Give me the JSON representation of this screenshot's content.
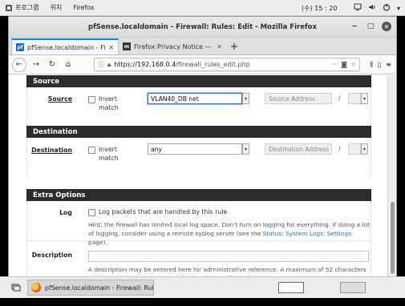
{
  "gnome_panel": {
    "apps_menu": "프로그램",
    "places_menu": "위치",
    "active_app": "Firefox",
    "clock": "(수) 15 : 20"
  },
  "window": {
    "title": "pfSense.localdomain - Firewall: Rules: Edit - Mozilla Firefox"
  },
  "tabs": [
    {
      "label": "pfSense.localdomain - Fi",
      "active": true,
      "icon": "pfsense-favicon"
    },
    {
      "label": "Firefox Privacy Notice — M",
      "active": false,
      "icon": "mozilla-favicon"
    }
  ],
  "navbar": {
    "url_host": "https://192.168.0.4",
    "url_path": "/firewall_rules_edit.php",
    "more_dots": "···"
  },
  "sections": {
    "source": {
      "header": "Source",
      "label": "Source",
      "invert_label_line1": "Invert",
      "invert_label_line2": "match",
      "select_value": "VLAN40_DB net",
      "address_placeholder": "Source Address",
      "slash": "/"
    },
    "destination": {
      "header": "Destination",
      "label": "Destination",
      "invert_label_line1": "Invert",
      "invert_label_line2": "match",
      "select_value": "any",
      "address_placeholder": "Destination Address",
      "slash": "/"
    },
    "extra": {
      "header": "Extra Options",
      "log_label": "Log",
      "log_checkbox_text": "Log packets that are handled by this rule",
      "log_hint_line1": "Hint: the firewall has limited local log space. Don't turn on logging for everything. If doing a lot",
      "log_hint_line2_pre": "of logging, consider using a remote syslog server (see the ",
      "log_hint_link": "Status: System Logs: Settings",
      "log_hint_line2_post": " page).",
      "description_label": "Description",
      "description_value": "",
      "description_hint_line1": "A description may be entered here for administrative reference. A maximum of 52 characters",
      "description_hint_line2": "will be used in the ruleset and displayed in the firewall log."
    }
  },
  "taskbar": {
    "item_label": "pfSense.localdomain - Firewall: Rule…"
  }
}
